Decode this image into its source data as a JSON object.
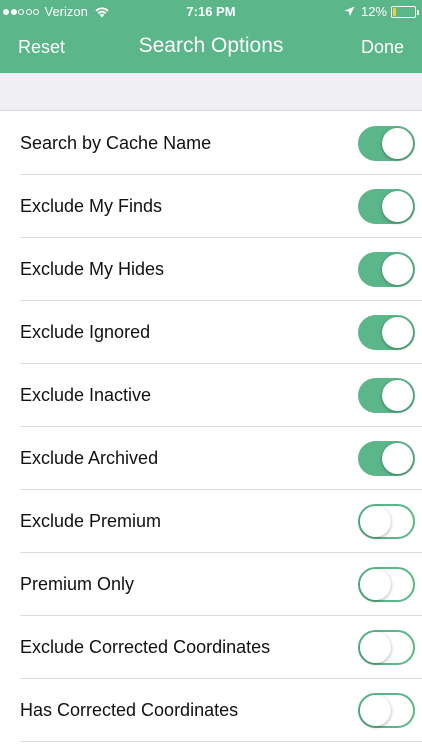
{
  "status_bar": {
    "carrier": "Verizon",
    "signal_bars_filled": 2,
    "signal_bars_total": 5,
    "time": "7:16 PM",
    "battery_percent_label": "12%",
    "battery_level": 0.12,
    "battery_color": "#f1d13b"
  },
  "nav": {
    "left_button": "Reset",
    "title": "Search Options",
    "right_button": "Done"
  },
  "theme": {
    "accent": "#5bb68a",
    "section_gap": "#efeff4"
  },
  "options": [
    {
      "label": "Search by Cache Name",
      "on": true
    },
    {
      "label": "Exclude My Finds",
      "on": true
    },
    {
      "label": "Exclude My Hides",
      "on": true
    },
    {
      "label": "Exclude Ignored",
      "on": true
    },
    {
      "label": "Exclude Inactive",
      "on": true
    },
    {
      "label": "Exclude Archived",
      "on": true
    },
    {
      "label": "Exclude Premium",
      "on": false
    },
    {
      "label": "Premium Only",
      "on": false
    },
    {
      "label": "Exclude Corrected Coordinates",
      "on": false
    },
    {
      "label": "Has Corrected Coordinates",
      "on": false
    }
  ]
}
